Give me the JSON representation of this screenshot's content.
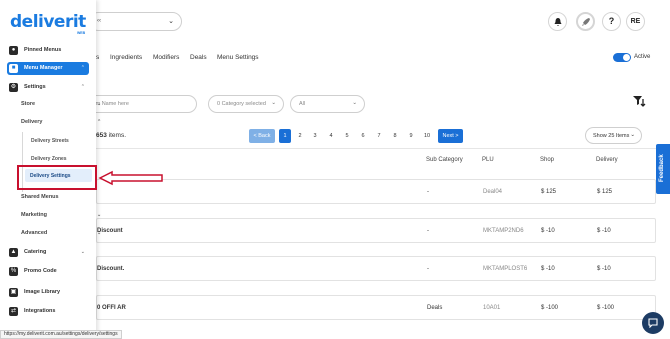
{
  "brand": {
    "logo": "deliverit",
    "sub": "WEB"
  },
  "header": {
    "branch_value": "‹‹",
    "user_initials": "RE",
    "help_label": "?"
  },
  "tabs": [
    "s",
    "Ingredients",
    "Modifiers",
    "Deals",
    "Menu Settings"
  ],
  "active_toggle_label": "Active",
  "filters": {
    "search_placeholder": "tem Name here",
    "category": "0 Category selected",
    "all": "All"
  },
  "items_count": {
    "number": "653",
    "suffix": " items."
  },
  "pagination": {
    "prev": "< Back",
    "pages": [
      "1",
      "2",
      "3",
      "4",
      "5",
      "6",
      "7",
      "8",
      "9",
      "10"
    ],
    "next": "Next >",
    "active_page": "1"
  },
  "show_items": "Show 25 Items",
  "columns": [
    "Sub Category",
    "PLU",
    "Shop",
    "Delivery"
  ],
  "rows": [
    {
      "name": "",
      "sub_category": "-",
      "plu": "Deal04",
      "shop": "$ 125",
      "delivery": "$ 125"
    },
    {
      "name": "Discount",
      "sub_category": "-",
      "plu": "MKTAMP2ND6",
      "shop": "$ -10",
      "delivery": "$ -10"
    },
    {
      "name": "Discount.",
      "sub_category": "-",
      "plu": "MKTAMPLOST6",
      "shop": "$ -10",
      "delivery": "$ -10"
    },
    {
      "name": "0 OFFI AR",
      "sub_category": "Deals",
      "plu": "10A01",
      "shop": "$ -100",
      "delivery": "$ -100"
    }
  ],
  "sidebar": {
    "pinned": "Pinned Menus",
    "menu_manager": "Menu Manager",
    "settings": "Settings",
    "store": "Store",
    "delivery": "Delivery",
    "delivery_streets": "Delivery Streets",
    "delivery_zones": "Delivery Zones",
    "delivery_settings": "Delivery Settings",
    "shared_menus": "Shared Menus",
    "marketing": "Marketing",
    "advanced": "Advanced",
    "catering": "Catering",
    "promo_code": "Promo Code",
    "image_library": "Image Library",
    "integrations": "Integrations"
  },
  "feedback": "Feedback",
  "status_url": "https://my.deliverit.com.au/settings/delivery/settings",
  "colors": {
    "primary": "#1a7be0",
    "highlight": "#c8102e",
    "chat": "#1d3c64"
  }
}
